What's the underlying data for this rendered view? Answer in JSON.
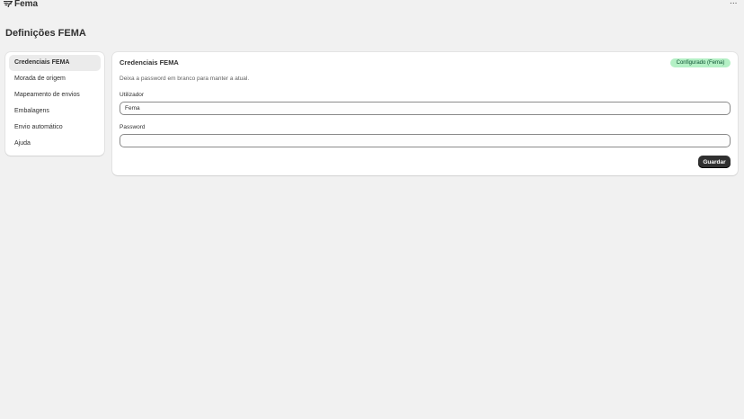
{
  "app": {
    "name": "Fema",
    "logo_icon": "fema-logo-icon",
    "menu_icon": "more-horizontal-icon",
    "menu_glyph": "···"
  },
  "page": {
    "title": "Definições FEMA"
  },
  "sidebar": {
    "items": [
      {
        "label": "Credenciais FEMA",
        "active": true
      },
      {
        "label": "Morada de origem",
        "active": false
      },
      {
        "label": "Mapeamento de envios",
        "active": false
      },
      {
        "label": "Embalagens",
        "active": false
      },
      {
        "label": "Envio automático",
        "active": false
      },
      {
        "label": "Ajuda",
        "active": false
      }
    ]
  },
  "main": {
    "title": "Credenciais FEMA",
    "status_badge": "Configurado (Fema)",
    "hint": "Deixa a password em branco para manter a atual.",
    "username": {
      "label": "Utilizador",
      "value": "Fema",
      "placeholder": ""
    },
    "password": {
      "label": "Password",
      "value": "",
      "placeholder": ""
    },
    "save_label": "Guardar"
  },
  "colors": {
    "badge_bg": "#b4f0c5",
    "badge_text": "#0c5132",
    "primary_button": "#303030",
    "page_bg": "#f1f1f1"
  }
}
